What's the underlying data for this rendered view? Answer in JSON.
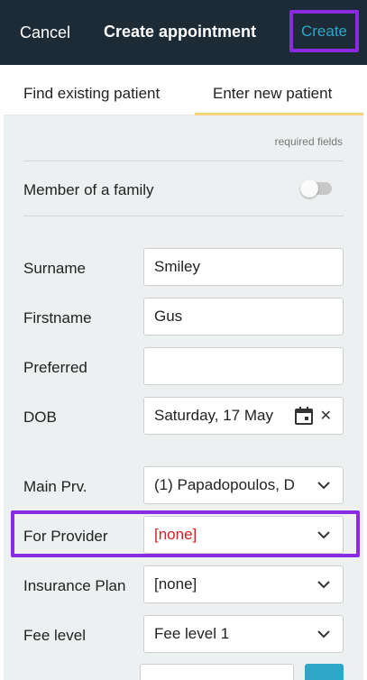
{
  "header": {
    "cancel_label": "Cancel",
    "title": "Create appointment",
    "create_label": "Create"
  },
  "tabs": [
    {
      "label": "Find existing patient",
      "active": false
    },
    {
      "label": "Enter new patient",
      "active": true
    }
  ],
  "form": {
    "required_note": "required fields",
    "member_of_family": {
      "label": "Member of a family",
      "on": false
    },
    "surname": {
      "label": "Surname",
      "value": "Smiley"
    },
    "firstname": {
      "label": "Firstname",
      "value": "Gus"
    },
    "preferred": {
      "label": "Preferred",
      "value": ""
    },
    "dob": {
      "label": "DOB",
      "value": "Saturday, 17 May"
    },
    "main_prv": {
      "label": "Main Prv.",
      "value": "(1) Papadopoulos, D"
    },
    "for_provider": {
      "label": "For Provider",
      "value": "[none]"
    },
    "insurance_plan": {
      "label": "Insurance Plan",
      "value": "[none]"
    },
    "fee_level": {
      "label": "Fee level",
      "value": "Fee level 1"
    }
  },
  "icons": {
    "dropdown": "chevron-down-icon",
    "calendar": "calendar-icon",
    "clear": "close-icon"
  },
  "colors": {
    "header_bg": "#1c2b36",
    "create_text": "#2ea7c9",
    "highlight_outline": "#8a2be2",
    "tab_underline": "#f2d27a",
    "form_bg": "#ecf0f1",
    "error_text": "#d32020"
  }
}
